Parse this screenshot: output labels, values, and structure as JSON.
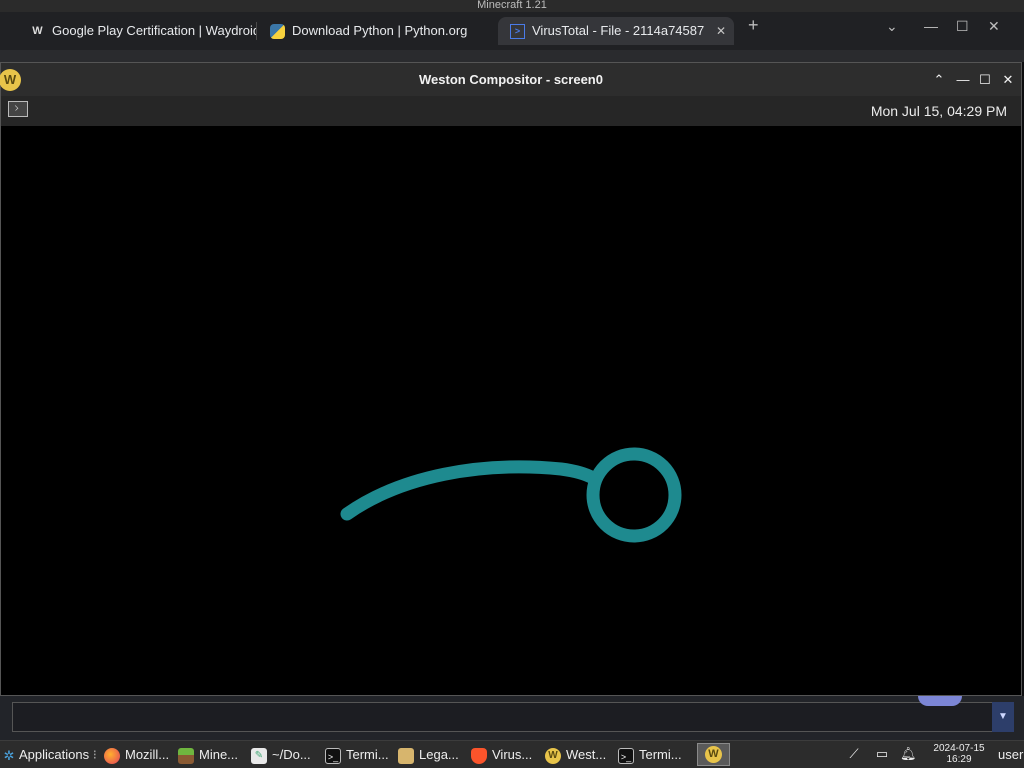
{
  "background_window": {
    "title": "Minecraft 1.21"
  },
  "browser": {
    "tabs": [
      {
        "icon": "wikipedia-icon",
        "label": "Google Play Certification | Waydroid"
      },
      {
        "icon": "python-icon",
        "label": "Download Python | Python.org"
      },
      {
        "icon": "virustotal-icon",
        "label": "VirusTotal - File - 2114a74587",
        "active": true
      }
    ],
    "new_tab": "+",
    "tab_list": "⌄",
    "minimize": "—",
    "maximize": "☐",
    "close": "✕"
  },
  "weston": {
    "title": "Weston Compositor - screen0",
    "logo": "W",
    "buttons": {
      "up": "⌃",
      "minimize": "—",
      "maximize": "☐",
      "close": "✕"
    },
    "clock": "Mon Jul 15, 04:29 PM",
    "stroke_color": "#1e8a8f"
  },
  "taskbar": {
    "apps_menu": "Applications",
    "items": [
      {
        "name": "firefox",
        "label": "Mozill..."
      },
      {
        "name": "minecraft",
        "label": "Mine..."
      },
      {
        "name": "files",
        "label": "~/Do..."
      },
      {
        "name": "terminal-1",
        "label": "Termi..."
      },
      {
        "name": "legacy",
        "label": "Lega..."
      },
      {
        "name": "brave",
        "label": "Virus..."
      },
      {
        "name": "weston",
        "label": "West..."
      },
      {
        "name": "terminal-2",
        "label": "Termi..."
      }
    ],
    "date": "2024-07-15",
    "time": "16:29",
    "user": "user"
  }
}
